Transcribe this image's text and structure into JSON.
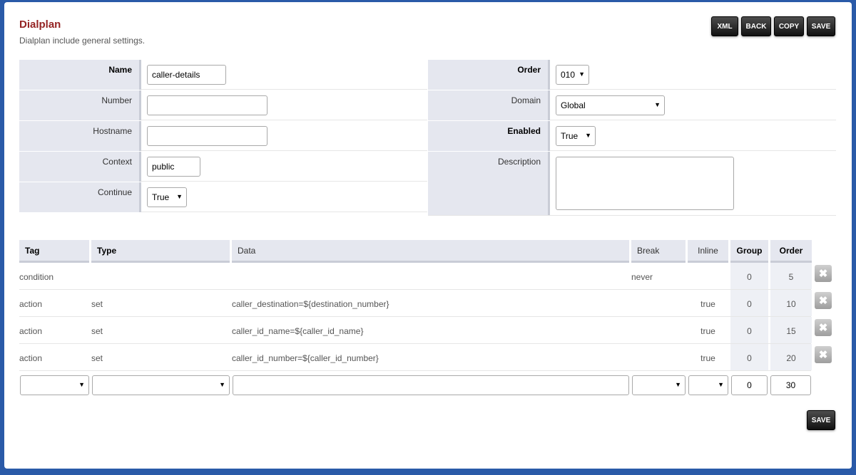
{
  "header": {
    "title": "Dialplan",
    "subtitle": "Dialplan include general settings."
  },
  "toolbar": {
    "xml": "XML",
    "back": "BACK",
    "copy": "COPY",
    "save": "SAVE"
  },
  "form": {
    "name_label": "Name",
    "name_value": "caller-details",
    "number_label": "Number",
    "number_value": "",
    "hostname_label": "Hostname",
    "hostname_value": "",
    "context_label": "Context",
    "context_value": "public",
    "continue_label": "Continue",
    "continue_value": "True",
    "order_label": "Order",
    "order_value": "010",
    "domain_label": "Domain",
    "domain_value": "Global",
    "enabled_label": "Enabled",
    "enabled_value": "True",
    "description_label": "Description",
    "description_value": ""
  },
  "table": {
    "headers": {
      "tag": "Tag",
      "type": "Type",
      "data": "Data",
      "break": "Break",
      "inline": "Inline",
      "group": "Group",
      "order": "Order"
    },
    "rows": [
      {
        "tag": "condition",
        "type": "",
        "data": "",
        "break": "never",
        "inline": "",
        "group": "0",
        "order": "5"
      },
      {
        "tag": "action",
        "type": "set",
        "data": "caller_destination=${destination_number}",
        "break": "",
        "inline": "true",
        "group": "0",
        "order": "10"
      },
      {
        "tag": "action",
        "type": "set",
        "data": "caller_id_name=${caller_id_name}",
        "break": "",
        "inline": "true",
        "group": "0",
        "order": "15"
      },
      {
        "tag": "action",
        "type": "set",
        "data": "caller_id_number=${caller_id_number}",
        "break": "",
        "inline": "true",
        "group": "0",
        "order": "20"
      }
    ],
    "new_row": {
      "group": "0",
      "order": "30"
    }
  },
  "footer": {
    "save": "SAVE"
  },
  "icons": {
    "delete": "close-icon",
    "dropdown": "chevron-down-icon"
  }
}
